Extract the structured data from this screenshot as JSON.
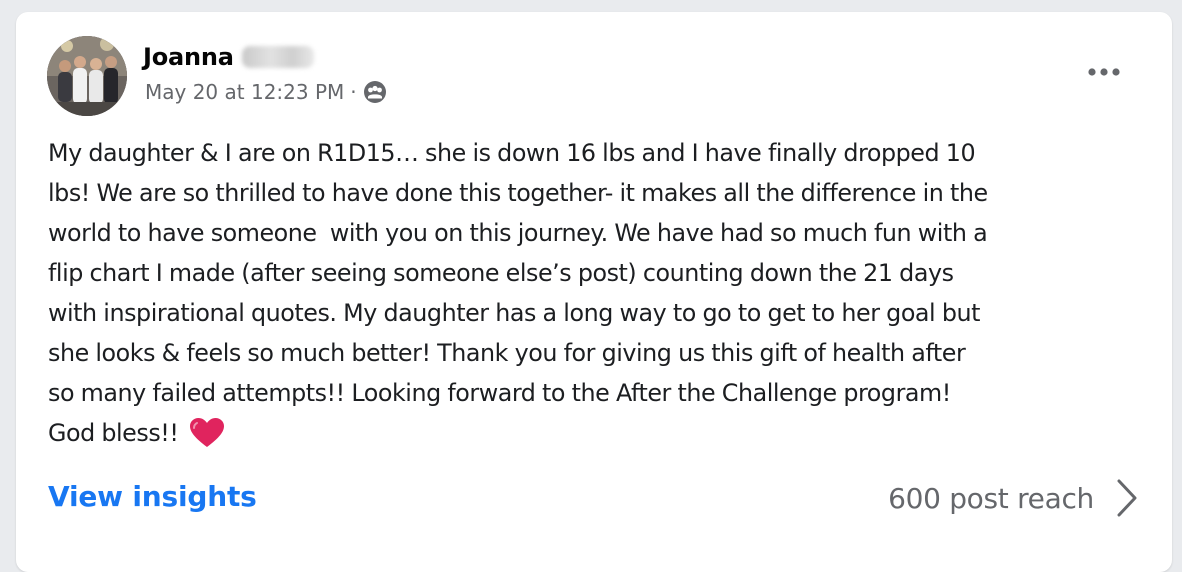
{
  "post": {
    "author_first_name": "Joanna",
    "timestamp": "May 20 at 12:23 PM",
    "separator": "·",
    "audience_icon": "group-audience-icon",
    "more_icon": "more-options-icon",
    "body": "My daughter & I are on R1D15… she is down 16 lbs and I have finally dropped 10\nlbs! We are so thrilled to have done this together- it makes all the difference in the\nworld to have someone  with you on this journey. We have had so much fun with a\nflip chart I made (after seeing someone else’s post) counting down the 21 days\nwith inspirational quotes. My daughter has a long way to go to get to her goal but\nshe looks & feels so much better! Thank you for giving us this gift of health after\nso many failed attempts!! Looking forward to the After the Challenge program!\nGod bless!! ",
    "emoji": "red-heart-icon"
  },
  "footer": {
    "insights_label": "View insights",
    "reach_label": "600 post reach",
    "chevron_icon": "chevron-right-icon"
  },
  "colors": {
    "link_blue": "#1877f2",
    "secondary_text": "#65676b",
    "heart_red": "#e0245e"
  }
}
